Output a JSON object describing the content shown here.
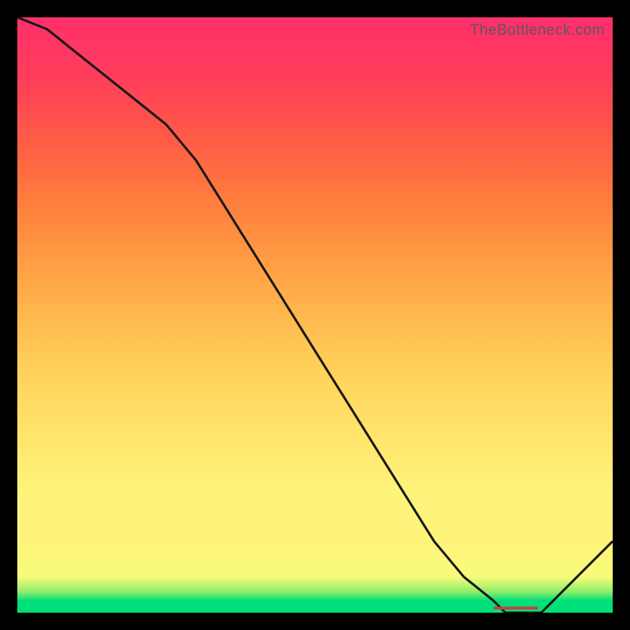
{
  "watermark": "TheBottleneck.com",
  "chart_data": {
    "type": "line",
    "title": "",
    "xlabel": "",
    "ylabel": "",
    "xlim": [
      0,
      100
    ],
    "ylim": [
      0,
      100
    ],
    "x": [
      0,
      5,
      10,
      15,
      20,
      25,
      30,
      35,
      40,
      45,
      50,
      55,
      60,
      65,
      70,
      75,
      80,
      82,
      85,
      88,
      90,
      95,
      100
    ],
    "values": [
      100,
      98,
      94,
      90,
      86,
      82,
      76,
      68,
      60,
      52,
      44,
      36,
      28,
      20,
      12,
      6,
      2,
      0,
      0,
      0,
      2,
      7,
      12
    ],
    "minimum": {
      "x_start": 80,
      "x_end": 88,
      "y": 0,
      "label": "-"
    },
    "green_band_pct": 2.5,
    "pale_band_pct": 12
  }
}
